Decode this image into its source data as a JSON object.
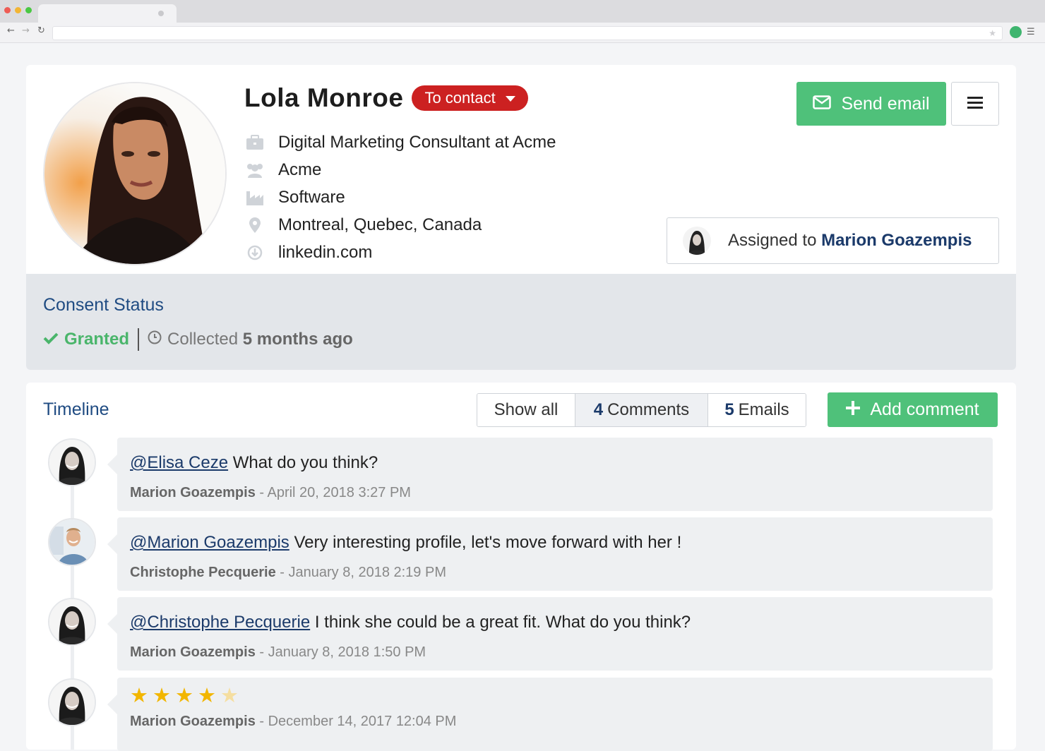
{
  "colors": {
    "accent_green": "#4fc17a",
    "status_red": "#cc2121",
    "link_blue": "#1b3a6a",
    "heading_blue": "#1f4b82",
    "star_gold": "#f2b600",
    "star_empty": "#f5deA0"
  },
  "profile": {
    "name": "Lola Monroe",
    "status": "To contact",
    "info": [
      {
        "icon": "briefcase-icon",
        "text": "Digital Marketing Consultant at Acme"
      },
      {
        "icon": "people-icon",
        "text": "Acme"
      },
      {
        "icon": "factory-icon",
        "text": "Software"
      },
      {
        "icon": "map-pin-icon",
        "text": "Montreal, Quebec, Canada"
      },
      {
        "icon": "source-icon",
        "text": "linkedin.com"
      }
    ],
    "send_email_label": "Send email",
    "assigned_prefix": "Assigned to",
    "assigned_name": "Marion Goazempis"
  },
  "consent": {
    "title": "Consent Status",
    "granted_label": "Granted",
    "collected_prefix": "Collected",
    "collected_when": "5 months ago"
  },
  "timeline": {
    "title": "Timeline",
    "filters": {
      "show_all": "Show all",
      "comments_count": "4",
      "comments_label": "Comments",
      "emails_count": "5",
      "emails_label": "Emails"
    },
    "add_comment_label": "Add comment",
    "entries": [
      {
        "mention": "@Elisa Ceze",
        "text": " What do you think?",
        "author": "Marion Goazempis",
        "date": "- April 20, 2018 3:27 PM"
      },
      {
        "mention": "@Marion Goazempis",
        "text": " Very interesting profile, let's move forward with her !",
        "author": "Christophe Pecquerie",
        "date": "- January 8, 2018 2:19 PM"
      },
      {
        "mention": "@Christophe Pecquerie",
        "text": " I think she could be a great fit. What do you think?",
        "author": "Marion Goazempis",
        "date": "- January 8, 2018 1:50 PM"
      },
      {
        "rating": 4,
        "rating_max": 5,
        "author": "Marion Goazempis",
        "date": "- December 14, 2017 12:04 PM"
      }
    ]
  }
}
